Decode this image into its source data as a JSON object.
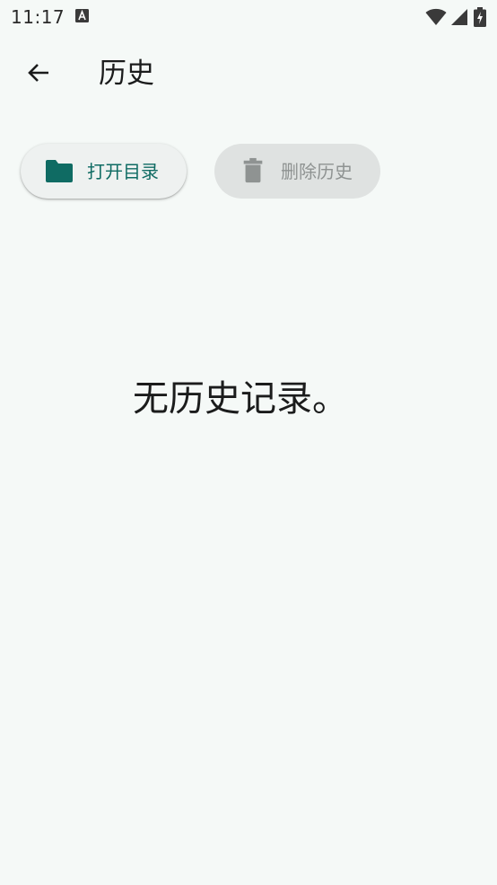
{
  "status_bar": {
    "time": "11:17",
    "notification_icon": "text-a-icon",
    "wifi_icon": "wifi-icon",
    "signal_icon": "cellular-signal-icon",
    "battery_icon": "battery-charging-icon"
  },
  "app_bar": {
    "back_icon": "arrow-back-icon",
    "title": "历史"
  },
  "actions": {
    "open_directory": {
      "label": "打开目录",
      "icon": "folder-icon",
      "enabled": true
    },
    "delete_history": {
      "label": "删除历史",
      "icon": "trash-icon",
      "enabled": false
    }
  },
  "empty_state": {
    "message": "无历史记录。"
  },
  "colors": {
    "background": "#f5f9f7",
    "accent": "#0f6b63",
    "disabled_text": "#8f9392",
    "disabled_chip": "#dfe2e1"
  }
}
